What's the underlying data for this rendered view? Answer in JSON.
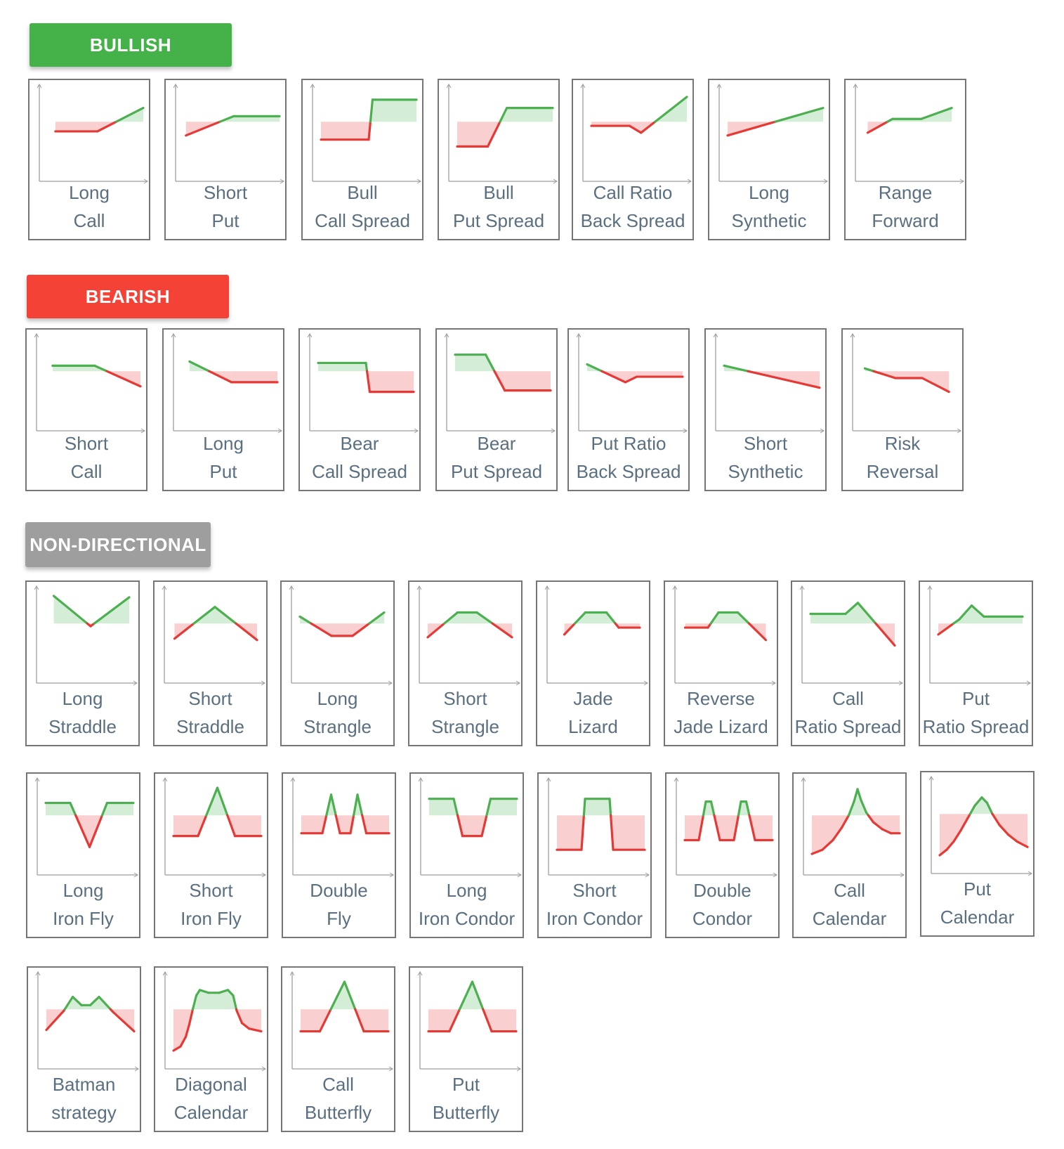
{
  "colors": {
    "profit": "#4caf50",
    "loss": "#e53935",
    "profit_fill": "#d4edd6",
    "loss_fill": "#f9cfcf",
    "axis": "#9e9e9e"
  },
  "sections": [
    {
      "title": "BULLISH",
      "color": "#45b149",
      "strategies": [
        {
          "id": "long-call",
          "line1": "Long",
          "line2": "Call",
          "shape": "long-call"
        },
        {
          "id": "short-put",
          "line1": "Short",
          "line2": "Put",
          "shape": "short-put"
        },
        {
          "id": "bull-call-spread",
          "line1": "Bull",
          "line2": "Call Spread",
          "shape": "bull-call-spread"
        },
        {
          "id": "bull-put-spread",
          "line1": "Bull",
          "line2": "Put Spread",
          "shape": "bull-put-spread"
        },
        {
          "id": "call-ratio-back-spread",
          "line1": "Call Ratio",
          "line2": "Back Spread",
          "shape": "call-ratio-back-spread"
        },
        {
          "id": "long-synthetic",
          "line1": "Long",
          "line2": "Synthetic",
          "shape": "long-synthetic"
        },
        {
          "id": "range-forward",
          "line1": "Range",
          "line2": "Forward",
          "shape": "range-forward"
        }
      ]
    },
    {
      "title": "BEARISH",
      "color": "#f44236",
      "strategies": [
        {
          "id": "short-call",
          "line1": "Short",
          "line2": "Call",
          "shape": "short-call"
        },
        {
          "id": "long-put",
          "line1": "Long",
          "line2": "Put",
          "shape": "long-put"
        },
        {
          "id": "bear-call-spread",
          "line1": "Bear",
          "line2": "Call Spread",
          "shape": "bear-call-spread"
        },
        {
          "id": "bear-put-spread",
          "line1": "Bear",
          "line2": "Put Spread",
          "shape": "bear-put-spread"
        },
        {
          "id": "put-ratio-back-spread",
          "line1": "Put Ratio",
          "line2": "Back Spread",
          "shape": "put-ratio-back-spread"
        },
        {
          "id": "short-synthetic",
          "line1": "Short",
          "line2": "Synthetic",
          "shape": "short-synthetic"
        },
        {
          "id": "risk-reversal",
          "line1": "Risk",
          "line2": "Reversal",
          "shape": "risk-reversal"
        }
      ]
    },
    {
      "title": "NON-DIRECTIONAL",
      "color": "#9e9e9e",
      "strategies": [
        {
          "id": "long-straddle",
          "line1": "Long",
          "line2": "Straddle",
          "shape": "long-straddle"
        },
        {
          "id": "short-straddle",
          "line1": "Short",
          "line2": "Straddle",
          "shape": "short-straddle"
        },
        {
          "id": "long-strangle",
          "line1": "Long",
          "line2": "Strangle",
          "shape": "long-strangle"
        },
        {
          "id": "short-strangle",
          "line1": "Short",
          "line2": "Strangle",
          "shape": "short-strangle"
        },
        {
          "id": "jade-lizard",
          "line1": "Jade",
          "line2": "Lizard",
          "shape": "jade-lizard"
        },
        {
          "id": "reverse-jade-lizard",
          "line1": "Reverse",
          "line2": "Jade Lizard",
          "shape": "reverse-jade-lizard"
        },
        {
          "id": "call-ratio-spread",
          "line1": "Call",
          "line2": "Ratio Spread",
          "shape": "call-ratio-spread"
        },
        {
          "id": "put-ratio-spread",
          "line1": "Put",
          "line2": "Ratio Spread",
          "shape": "put-ratio-spread"
        },
        {
          "id": "long-iron-fly",
          "line1": "Long",
          "line2": "Iron Fly",
          "shape": "long-iron-fly"
        },
        {
          "id": "short-iron-fly",
          "line1": "Short",
          "line2": "Iron Fly",
          "shape": "short-iron-fly"
        },
        {
          "id": "double-fly",
          "line1": "Double",
          "line2": "Fly",
          "shape": "double-fly"
        },
        {
          "id": "long-iron-condor",
          "line1": "Long",
          "line2": "Iron Condor",
          "shape": "long-iron-condor"
        },
        {
          "id": "short-iron-condor",
          "line1": "Short",
          "line2": "Iron Condor",
          "shape": "short-iron-condor"
        },
        {
          "id": "double-condor",
          "line1": "Double",
          "line2": "Condor",
          "shape": "double-condor"
        },
        {
          "id": "call-calendar",
          "line1": "Call",
          "line2": "Calendar",
          "shape": "call-calendar"
        },
        {
          "id": "put-calendar",
          "line1": "Put",
          "line2": "Calendar",
          "shape": "put-calendar"
        },
        {
          "id": "batman-strategy",
          "line1": "Batman",
          "line2": "strategy",
          "shape": "batman-strategy"
        },
        {
          "id": "diagonal-calendar",
          "line1": "Diagonal",
          "line2": "Calendar",
          "shape": "diagonal-calendar"
        },
        {
          "id": "call-butterfly",
          "line1": "Call",
          "line2": "Butterfly",
          "shape": "call-butterfly"
        },
        {
          "id": "put-butterfly",
          "line1": "Put",
          "line2": "Butterfly",
          "shape": "put-butterfly"
        }
      ]
    }
  ]
}
